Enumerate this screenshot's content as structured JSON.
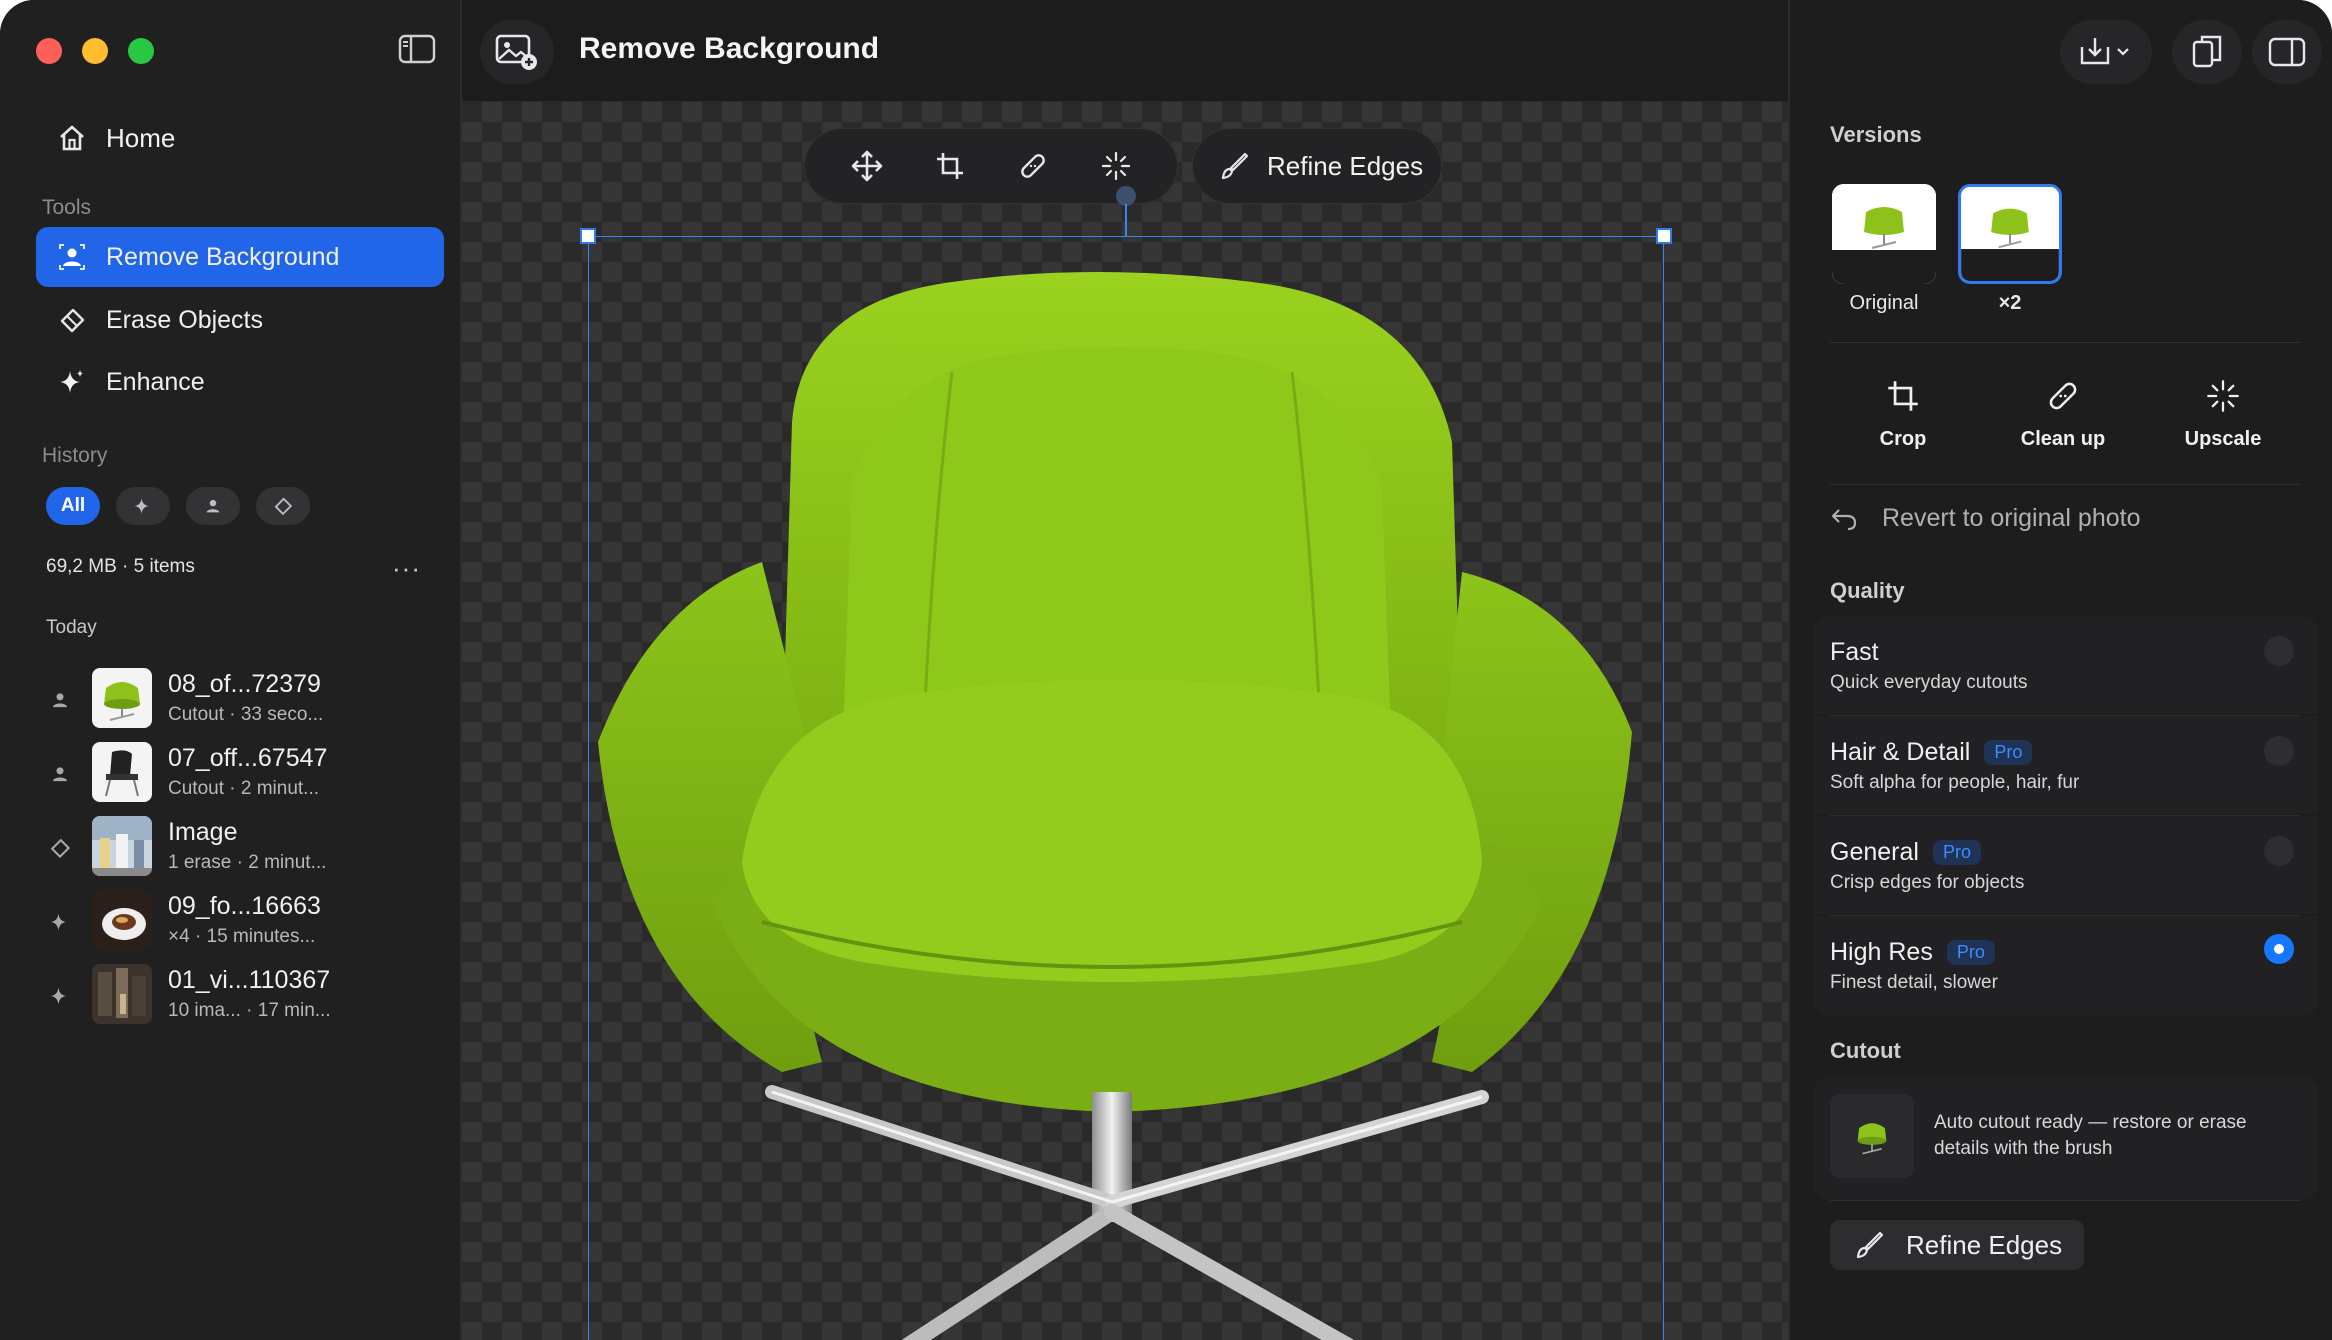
{
  "app": {
    "title": "Remove Background"
  },
  "sidebar": {
    "home_label": "Home",
    "tools_section": "Tools",
    "tools": [
      {
        "label": "Remove Background",
        "icon": "person-cutout-icon",
        "active": true
      },
      {
        "label": "Erase Objects",
        "icon": "eraser-icon",
        "active": false
      },
      {
        "label": "Enhance",
        "icon": "sparkle-icon",
        "active": false
      }
    ],
    "history_section": "History",
    "filters": [
      {
        "label": "All",
        "active": true
      },
      {
        "label": "",
        "icon": "sparkle-icon"
      },
      {
        "label": "",
        "icon": "person-cutout-icon"
      },
      {
        "label": "",
        "icon": "eraser-icon"
      }
    ],
    "storage": "69,2 MB · 5 items",
    "more": "···",
    "today_label": "Today",
    "history": [
      {
        "name": "08_of...72379",
        "meta": "Cutout · 33 seco...",
        "type_icon": "person-cutout-icon"
      },
      {
        "name": "07_off...67547",
        "meta": "Cutout · 2 minut...",
        "type_icon": "person-cutout-icon"
      },
      {
        "name": "Image",
        "meta": "1 erase · 2 minut...",
        "type_icon": "eraser-icon"
      },
      {
        "name": "09_fo...16663",
        "meta": "×4 · 15 minutes...",
        "type_icon": "sparkle-icon"
      },
      {
        "name": "01_vi...110367",
        "meta": "10 ima... · 17 min...",
        "type_icon": "sparkle-icon"
      }
    ]
  },
  "canvas": {
    "refine_label": "Refine Edges",
    "tools": [
      "move-icon",
      "crop-icon",
      "bandage-icon",
      "magic-wand-icon"
    ]
  },
  "panel": {
    "versions_label": "Versions",
    "versions": [
      {
        "label": "Original",
        "selected": false
      },
      {
        "label": "×2",
        "selected": true
      }
    ],
    "actions": [
      {
        "label": "Crop",
        "icon": "crop-icon"
      },
      {
        "label": "Clean up",
        "icon": "bandage-icon"
      },
      {
        "label": "Upscale",
        "icon": "magic-wand-icon"
      }
    ],
    "revert_label": "Revert to original photo",
    "quality_label": "Quality",
    "quality": [
      {
        "name": "Fast",
        "desc": "Quick everyday cutouts",
        "pro": "",
        "selected": false
      },
      {
        "name": "Hair & Detail",
        "desc": "Soft alpha for people, hair, fur",
        "pro": "Pro",
        "selected": false
      },
      {
        "name": "General",
        "desc": "Crisp edges for objects",
        "pro": "Pro",
        "selected": false
      },
      {
        "name": "High Res",
        "desc": "Finest detail, slower",
        "pro": "Pro",
        "selected": true
      }
    ],
    "cutout_label": "Cutout",
    "cutout_text": "Auto cutout ready — restore or erase details with the brush",
    "refine_label": "Refine Edges"
  },
  "colors": {
    "accent": "#2166e8",
    "chair": "#8cc21a"
  }
}
